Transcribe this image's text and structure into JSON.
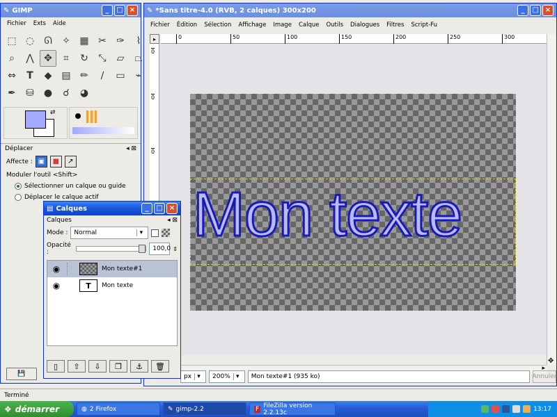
{
  "toolbox": {
    "title": "GIMP",
    "menu": [
      "Fichier",
      "Exts",
      "Aide"
    ],
    "options_title": "Déplacer",
    "affecte_label": "Affecte :",
    "moduler_label": "Moduler l'outil  <Shift>",
    "radio1": "Sélectionner un calque ou guide",
    "radio2": "Déplacer le calque actif"
  },
  "image_window": {
    "title": "*Sans titre-4.0 (RVB, 2 calques) 300x200",
    "menu": [
      "Fichier",
      "Édition",
      "Sélection",
      "Affichage",
      "Image",
      "Calque",
      "Outils",
      "Dialogues",
      "Filtres",
      "Script-Fu"
    ],
    "ruler_h": [
      "0",
      "50",
      "100",
      "150",
      "200",
      "250",
      "300"
    ],
    "ruler_v": [
      "0",
      "0",
      "0"
    ],
    "canvas_text": "Mon texte",
    "unit": "px",
    "zoom": "200%",
    "status": "Mon texte#1 (935 ko)",
    "undo_label": "Annuler"
  },
  "layers": {
    "title": "Calques",
    "panel_label": "Calques",
    "mode_label": "Mode :",
    "mode_value": "Normal",
    "opacity_label": "Opacité :",
    "opacity_value": "100,0",
    "items": [
      {
        "name": "Mon texte#1",
        "selected": true
      },
      {
        "name": "Mon texte",
        "selected": false
      }
    ]
  },
  "statusbar": {
    "text": "Terminé"
  },
  "taskbar": {
    "start": "démarrer",
    "tasks": [
      "2 Firefox",
      "gimp-2.2",
      "FileZilla version 2.2.13c"
    ],
    "clock": "13:17"
  },
  "colors": {
    "fg": "#a3a9ff",
    "bg": "#ffffff",
    "titlebar": "#1a57de",
    "text_stroke": "#1a1ab8"
  }
}
